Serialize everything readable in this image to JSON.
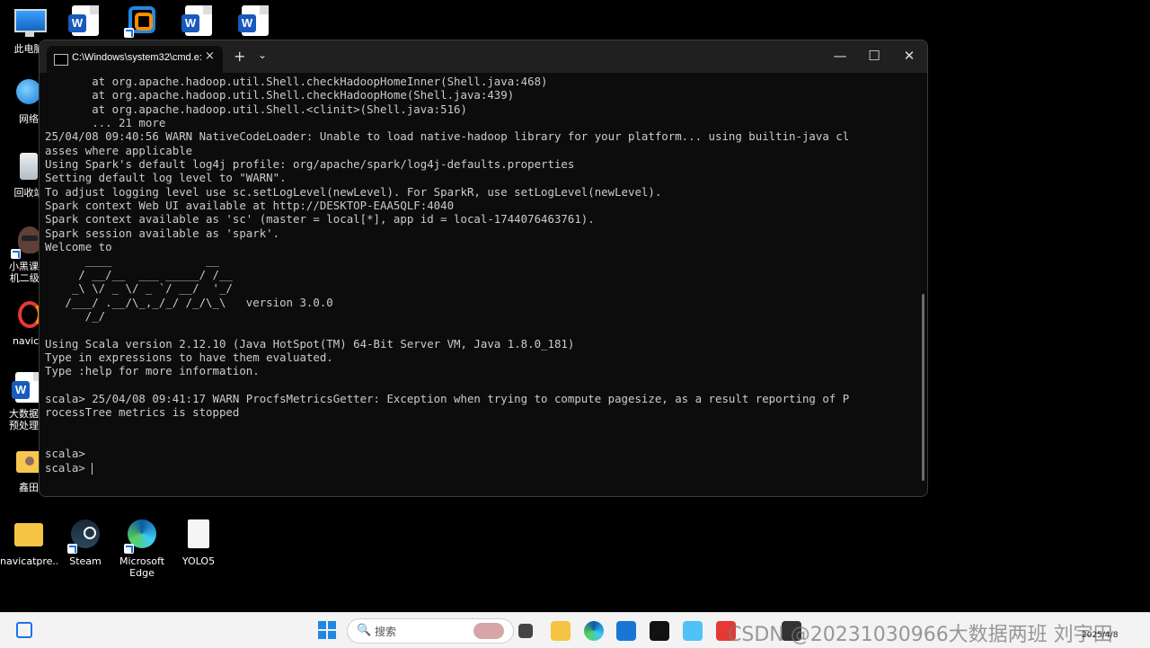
{
  "desktop": {
    "icons": [
      {
        "label": "此电脑"
      },
      {
        "label": "网络"
      },
      {
        "label": "回收站"
      },
      {
        "label": "小黑课堂\n机二级M"
      },
      {
        "label": "navica"
      },
      {
        "label": "大数据采\n预处理技"
      },
      {
        "label": "鑫田"
      },
      {
        "label": "navicatpre..."
      },
      {
        "label": "Steam"
      },
      {
        "label": "Microsoft\nEdge"
      },
      {
        "label": "YOLO5"
      }
    ]
  },
  "window": {
    "tab_title": "C:\\Windows\\system32\\cmd.e:",
    "tab_close": "×",
    "new_tab": "+",
    "tab_menu": "⌄",
    "minimize": "—",
    "maximize": "☐",
    "close": "✕",
    "terminal_lines": [
      "       at org.apache.hadoop.util.Shell.checkHadoopHomeInner(Shell.java:468)",
      "       at org.apache.hadoop.util.Shell.checkHadoopHome(Shell.java:439)",
      "       at org.apache.hadoop.util.Shell.<clinit>(Shell.java:516)",
      "       ... 21 more",
      "25/04/08 09:40:56 WARN NativeCodeLoader: Unable to load native-hadoop library for your platform... using builtin-java cl",
      "asses where applicable",
      "Using Spark's default log4j profile: org/apache/spark/log4j-defaults.properties",
      "Setting default log level to \"WARN\".",
      "To adjust logging level use sc.setLogLevel(newLevel). For SparkR, use setLogLevel(newLevel).",
      "Spark context Web UI available at http://DESKTOP-EAA5QLF:4040",
      "Spark context available as 'sc' (master = local[*], app id = local-1744076463761).",
      "Spark session available as 'spark'.",
      "Welcome to",
      "      ____              __",
      "     / __/__  ___ _____/ /__",
      "    _\\ \\/ _ \\/ _ `/ __/  '_/",
      "   /___/ .__/\\_,_/_/ /_/\\_\\   version 3.0.0",
      "      /_/",
      "",
      "Using Scala version 2.12.10 (Java HotSpot(TM) 64-Bit Server VM, Java 1.8.0_181)",
      "Type in expressions to have them evaluated.",
      "Type :help for more information.",
      "",
      "scala> 25/04/08 09:41:17 WARN ProcfsMetricsGetter: Exception when trying to compute pagesize, as a result reporting of P",
      "rocessTree metrics is stopped",
      "",
      "",
      "scala>",
      ""
    ],
    "prompt": "scala> "
  },
  "taskbar": {
    "search_placeholder": "搜索",
    "search_icon": "🔍",
    "watermark": "CSDN @202310309​66大数据两班  刘宇田",
    "clock_date": "2025/4/8"
  }
}
